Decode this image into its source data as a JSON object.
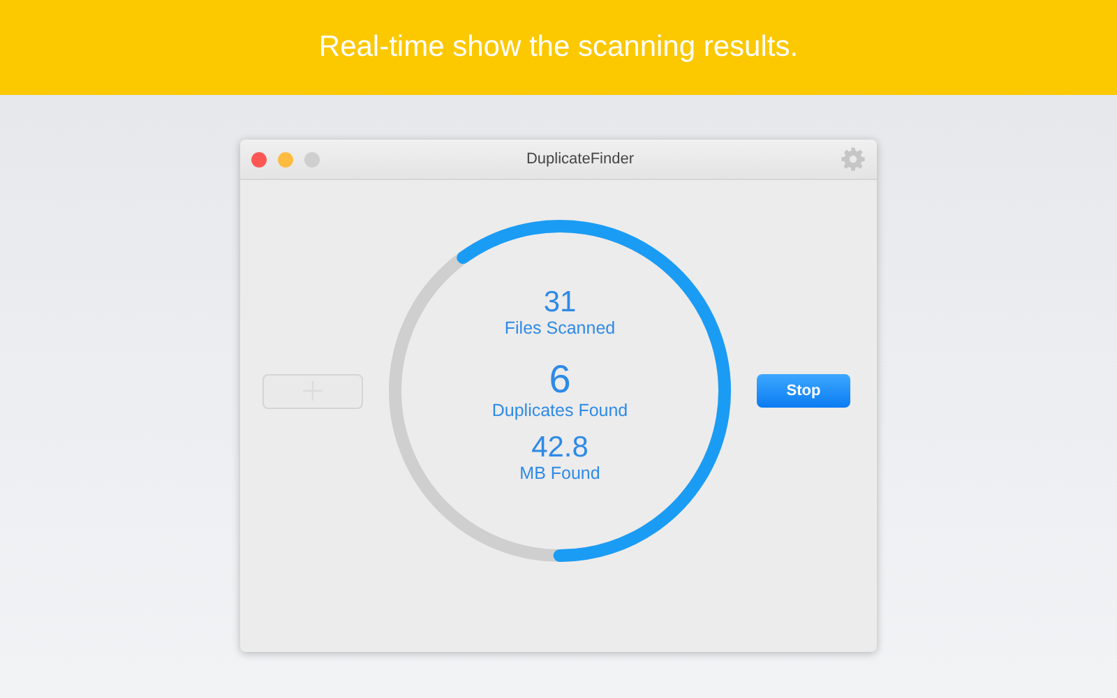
{
  "banner": {
    "text": "Real-time show the scanning results."
  },
  "window": {
    "title": "DuplicateFinder",
    "traffic_lights": [
      {
        "kind": "close",
        "disabled": false
      },
      {
        "kind": "minimize",
        "disabled": false
      },
      {
        "kind": "zoom",
        "disabled": true
      }
    ]
  },
  "add_button": {
    "disabled": true
  },
  "progress": {
    "level": 0.6
  },
  "stats": [
    {
      "value": "31",
      "label": "Files Scanned",
      "kind": "small"
    },
    {
      "value": "6",
      "label": "Duplicates Found",
      "kind": "large"
    },
    {
      "value": "42.8",
      "label": "MB Found",
      "kind": "small"
    }
  ],
  "stop_button": {
    "label": "Stop"
  }
}
